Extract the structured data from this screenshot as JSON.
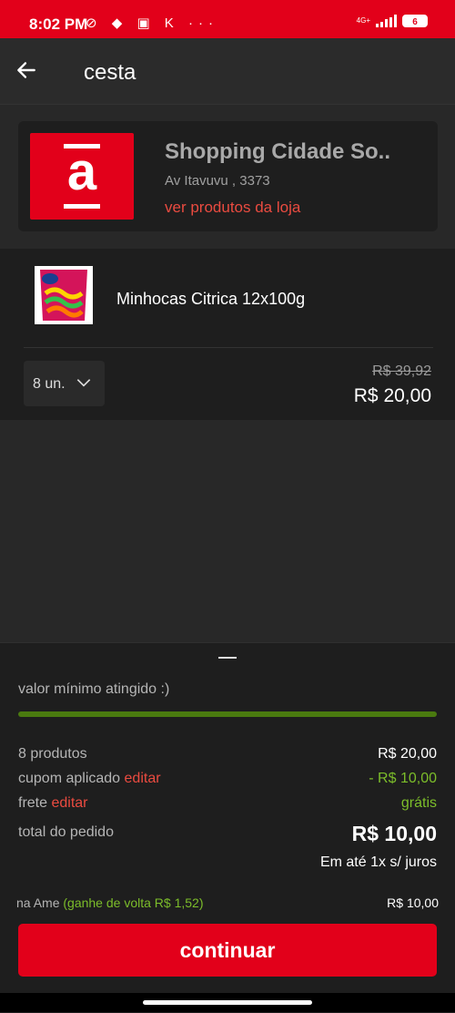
{
  "status_bar": {
    "time": "8:02 PM",
    "network": "4G+",
    "battery": "6"
  },
  "header": {
    "title": "cesta"
  },
  "store": {
    "name": "Shopping Cidade So..",
    "address": "Av Itavuvu , 3373",
    "link_label": "ver produtos da loja",
    "logo_letter": "a"
  },
  "product": {
    "name": "Minhocas Citrica 12x100g",
    "quantity_label": "8 un.",
    "old_price": "R$ 39,92",
    "price": "R$ 20,00"
  },
  "summary": {
    "min_value_text": "valor mínimo atingido :)",
    "progress_percent": 100,
    "products_label": "8 produtos",
    "products_value": "R$ 20,00",
    "coupon_label": "cupom aplicado",
    "coupon_edit": "editar",
    "coupon_value": "- R$ 10,00",
    "shipping_label": "frete",
    "shipping_edit": "editar",
    "shipping_value": "grátis",
    "total_label": "total do pedido",
    "total_value": "R$ 10,00",
    "installments": "Em até 1x s/ juros",
    "ame_label": "na Ame",
    "ame_cashback": "(ganhe de volta R$ 1,52)",
    "ame_value": "R$ 10,00",
    "continue_label": "continuar"
  },
  "colors": {
    "brand_red": "#e2001a",
    "link_red": "#ea4b40",
    "positive_green": "#7cbd2a",
    "progress_green": "#4a7a0f"
  }
}
